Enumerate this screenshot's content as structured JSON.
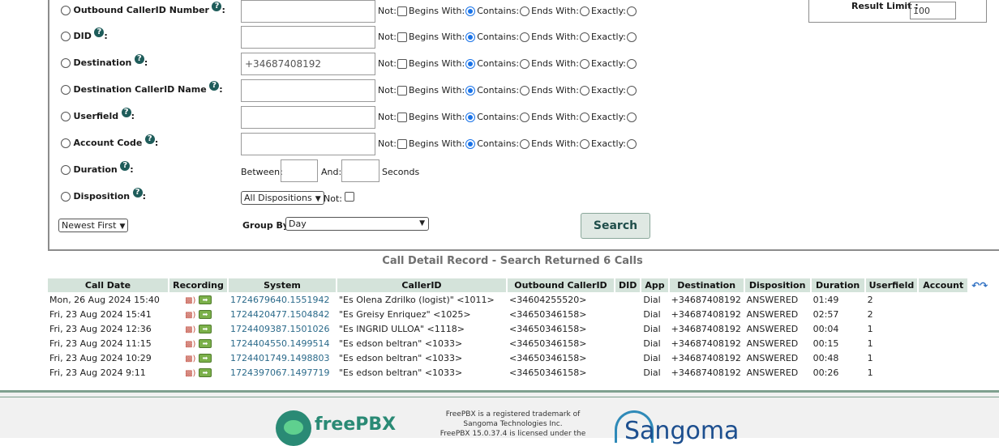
{
  "result_limit": {
    "label": "Result Limit :",
    "value": "100"
  },
  "option_labels": {
    "not": "Not:",
    "begins_with": "Begins With:",
    "contains": "Contains:",
    "ends_with": "Ends With:",
    "exactly": "Exactly:"
  },
  "fields": [
    {
      "label": "Outbound CallerID Number",
      "value": ""
    },
    {
      "label": "DID",
      "value": ""
    },
    {
      "label": "Destination",
      "value": "+34687408192"
    },
    {
      "label": "Destination CallerID Name",
      "value": ""
    },
    {
      "label": "Userfield",
      "value": ""
    },
    {
      "label": "Account Code",
      "value": ""
    }
  ],
  "duration": {
    "label": "Duration",
    "between": "Between:",
    "and": "And:",
    "seconds": "Seconds"
  },
  "disposition": {
    "label": "Disposition",
    "selected": "All Dispositions",
    "not": "Not:"
  },
  "order": {
    "selected": "Newest First"
  },
  "group_by": {
    "label": "Group By:",
    "selected": "Day"
  },
  "search_button": "Search",
  "heading": "Call Detail Record - Search Returned 6 Calls",
  "table": {
    "headers": [
      "Call Date",
      "Recording",
      "System",
      "CallerID",
      "Outbound CallerID",
      "DID",
      "App",
      "Destination",
      "Disposition",
      "Duration",
      "Userfield",
      "Account"
    ],
    "rows": [
      {
        "date": "Mon, 26 Aug 2024 15:40",
        "system": "1724679640.1551942",
        "callerid": "\"Es Olena Zdrilko (logist)\" <1011>",
        "outbound": "<34604255520>",
        "did": "",
        "app": "Dial",
        "destination": "+34687408192",
        "disposition": "ANSWERED",
        "duration": "01:49",
        "userfield": "2",
        "account": ""
      },
      {
        "date": "Fri, 23 Aug 2024 15:41",
        "system": "1724420477.1504842",
        "callerid": "\"Es Greisy Enriquez\" <1025>",
        "outbound": "<34650346158>",
        "did": "",
        "app": "Dial",
        "destination": "+34687408192",
        "disposition": "ANSWERED",
        "duration": "02:57",
        "userfield": "2",
        "account": ""
      },
      {
        "date": "Fri, 23 Aug 2024 12:36",
        "system": "1724409387.1501026",
        "callerid": "\"Es INGRID ULLOA\" <1118>",
        "outbound": "<34650346158>",
        "did": "",
        "app": "Dial",
        "destination": "+34687408192",
        "disposition": "ANSWERED",
        "duration": "00:04",
        "userfield": "1",
        "account": ""
      },
      {
        "date": "Fri, 23 Aug 2024 11:15",
        "system": "1724404550.1499514",
        "callerid": "\"Es edson beltran\" <1033>",
        "outbound": "<34650346158>",
        "did": "",
        "app": "Dial",
        "destination": "+34687408192",
        "disposition": "ANSWERED",
        "duration": "00:15",
        "userfield": "1",
        "account": ""
      },
      {
        "date": "Fri, 23 Aug 2024 10:29",
        "system": "1724401749.1498803",
        "callerid": "\"Es edson beltran\" <1033>",
        "outbound": "<34650346158>",
        "did": "",
        "app": "Dial",
        "destination": "+34687408192",
        "disposition": "ANSWERED",
        "duration": "00:48",
        "userfield": "1",
        "account": ""
      },
      {
        "date": "Fri, 23 Aug 2024 9:11",
        "system": "1724397067.1497719",
        "callerid": "\"Es edson beltran\" <1033>",
        "outbound": "<34650346158>",
        "did": "",
        "app": "Dial",
        "destination": "+34687408192",
        "disposition": "ANSWERED",
        "duration": "00:26",
        "userfield": "1",
        "account": ""
      }
    ]
  },
  "footer": {
    "brand": "freePBX",
    "legal_lines": [
      "FreePBX is a registered trademark of",
      "Sangoma Technologies Inc.",
      "FreePBX 15.0.37.4 is licensed under the"
    ],
    "partner": "Sangoma"
  },
  "icons": {
    "help": "question-circle-icon",
    "play": "speaker-icon",
    "download": "download-arrow-icon",
    "prev": "prev-page-icon",
    "next": "next-page-icon"
  },
  "colors": {
    "accent": "#1e5c5a",
    "header_bg": "#d4e3da",
    "link": "#2b6a8a",
    "brand_green": "#2a8a75",
    "sangoma_blue": "#1d4f8f"
  }
}
